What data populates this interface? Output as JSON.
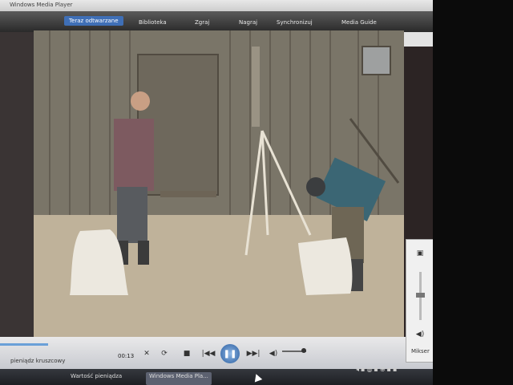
{
  "window": {
    "title": "Windows Media Player"
  },
  "tabs": [
    {
      "label": "Teraz odtwarzane",
      "active": true
    },
    {
      "label": "Biblioteka"
    },
    {
      "label": "Zgraj"
    },
    {
      "label": "Nagraj"
    },
    {
      "label": "Synchronizuj"
    },
    {
      "label": "Media Guide"
    }
  ],
  "controls": {
    "time": "00:13",
    "status": "pieniądz kruszcowy",
    "play_glyph": "❚❚",
    "prev_glyph": "|◀◀",
    "next_glyph": "▶▶|",
    "stop_glyph": "■",
    "shuffle_glyph": "✕",
    "repeat_glyph": "⟳",
    "volume_glyph": "◀)"
  },
  "mixer": {
    "label": "Mikser"
  },
  "taskbar": {
    "items": [
      {
        "label": "Wartość pieniądza"
      },
      {
        "label": "Windows Media Pla..."
      }
    ]
  },
  "colors": {
    "accent": "#3f6fb6",
    "taskbar": "#1d1f23"
  },
  "icons": [
    "shuffle-icon",
    "repeat-icon",
    "stop-icon",
    "prev-icon",
    "play-pause-icon",
    "next-icon",
    "volume-icon",
    "mute-icon",
    "window-icon",
    "mouse-cursor"
  ]
}
